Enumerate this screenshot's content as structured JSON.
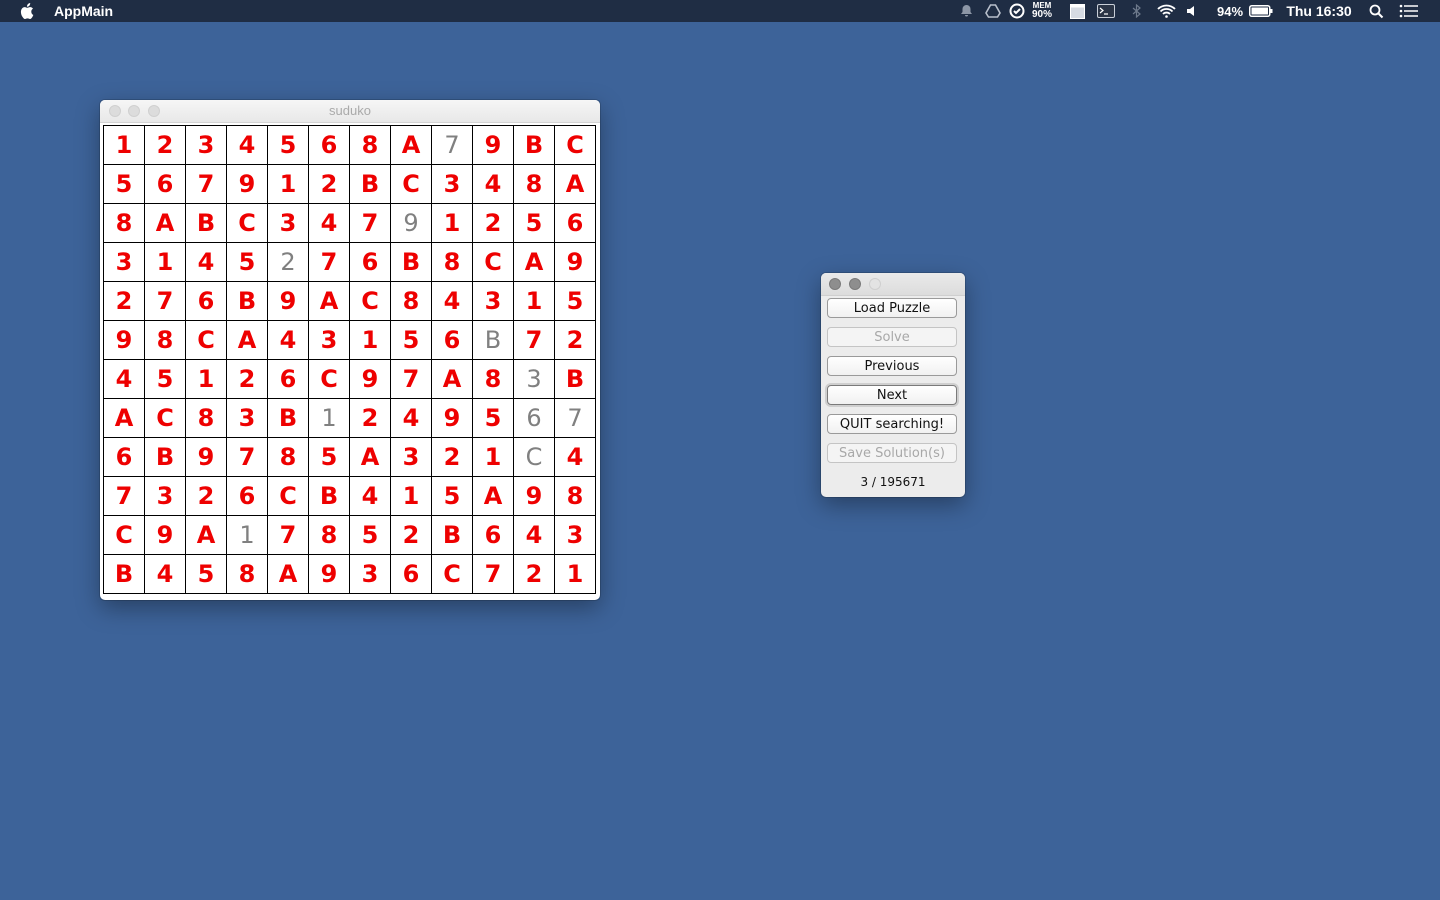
{
  "menubar": {
    "app_name": "AppMain",
    "mem_label": "MEM",
    "mem_value": "90%",
    "battery_percent": "94%",
    "clock": "Thu 16:30",
    "icons": [
      "apple-icon",
      "notification-bell-icon",
      "google-drive-icon",
      "mem-monitor-icon",
      "app-window-icon",
      "terminal-icon",
      "bluetooth-icon",
      "wifi-icon",
      "volume-icon",
      "battery-icon",
      "spotlight-search-icon",
      "notification-center-icon"
    ]
  },
  "sudoku_window": {
    "title": "suduko",
    "legend_colors": {
      "solved": "#ee0000",
      "given": "#808080"
    },
    "grid": [
      [
        "1",
        "2",
        "3",
        "4",
        "5",
        "6",
        "8",
        "A",
        "7",
        "9",
        "B",
        "C"
      ],
      [
        "5",
        "6",
        "7",
        "9",
        "1",
        "2",
        "B",
        "C",
        "3",
        "4",
        "8",
        "A"
      ],
      [
        "8",
        "A",
        "B",
        "C",
        "3",
        "4",
        "7",
        "9",
        "1",
        "2",
        "5",
        "6"
      ],
      [
        "3",
        "1",
        "4",
        "5",
        "2",
        "7",
        "6",
        "B",
        "8",
        "C",
        "A",
        "9"
      ],
      [
        "2",
        "7",
        "6",
        "B",
        "9",
        "A",
        "C",
        "8",
        "4",
        "3",
        "1",
        "5"
      ],
      [
        "9",
        "8",
        "C",
        "A",
        "4",
        "3",
        "1",
        "5",
        "6",
        "B",
        "7",
        "2"
      ],
      [
        "4",
        "5",
        "1",
        "2",
        "6",
        "C",
        "9",
        "7",
        "A",
        "8",
        "3",
        "B"
      ],
      [
        "A",
        "C",
        "8",
        "3",
        "B",
        "1",
        "2",
        "4",
        "9",
        "5",
        "6",
        "7"
      ],
      [
        "6",
        "B",
        "9",
        "7",
        "8",
        "5",
        "A",
        "3",
        "2",
        "1",
        "C",
        "4"
      ],
      [
        "7",
        "3",
        "2",
        "6",
        "C",
        "B",
        "4",
        "1",
        "5",
        "A",
        "9",
        "8"
      ],
      [
        "C",
        "9",
        "A",
        "1",
        "7",
        "8",
        "5",
        "2",
        "B",
        "6",
        "4",
        "3"
      ],
      [
        "B",
        "4",
        "5",
        "8",
        "A",
        "9",
        "3",
        "6",
        "C",
        "7",
        "2",
        "1"
      ]
    ],
    "given_cells": [
      [
        0,
        8
      ],
      [
        2,
        7
      ],
      [
        3,
        4
      ],
      [
        5,
        9
      ],
      [
        6,
        10
      ],
      [
        7,
        5
      ],
      [
        7,
        10
      ],
      [
        7,
        11
      ],
      [
        8,
        10
      ],
      [
        10,
        3
      ]
    ]
  },
  "control_window": {
    "buttons": {
      "load_puzzle": "Load Puzzle",
      "solve": "Solve",
      "previous": "Previous",
      "next": "Next",
      "quit": "QUIT searching!",
      "save": "Save Solution(s)"
    },
    "counter": "3 / 195671"
  }
}
